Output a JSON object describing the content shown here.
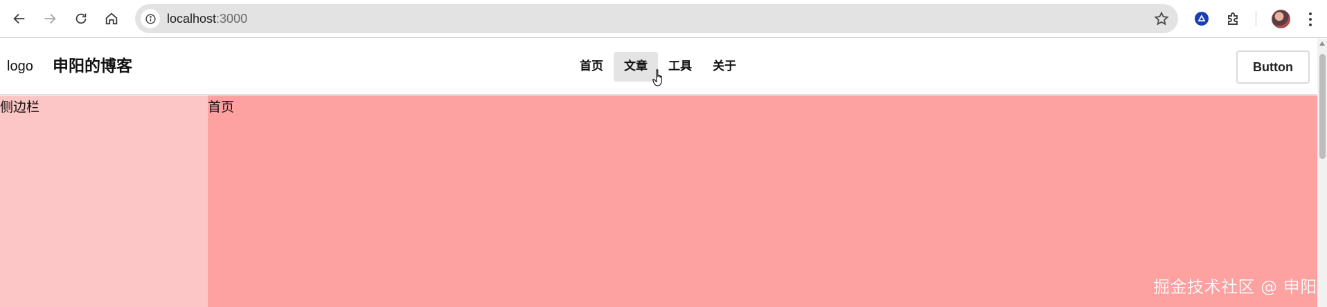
{
  "browser": {
    "url_host": "localhost",
    "url_port": ":3000",
    "icons": {
      "back": "arrow-left-icon",
      "forward": "arrow-right-icon",
      "reload": "reload-icon",
      "home": "home-icon",
      "site_info": "info-icon",
      "bookmark": "star-icon",
      "extension_a": "triangle-badge-icon",
      "extensions": "puzzle-icon",
      "menu": "kebab-menu-icon"
    }
  },
  "header": {
    "logo": "logo",
    "site_title": "申阳的博客",
    "nav": [
      {
        "label": "首页"
      },
      {
        "label": "文章",
        "hovered": true
      },
      {
        "label": "工具"
      },
      {
        "label": "关于"
      }
    ],
    "button_label": "Button"
  },
  "sidebar": {
    "label": "侧边栏",
    "color": "#fcc6c6"
  },
  "main": {
    "label": "首页",
    "color": "#fea1a1"
  },
  "watermark": "掘金技术社区 @ 申阳"
}
